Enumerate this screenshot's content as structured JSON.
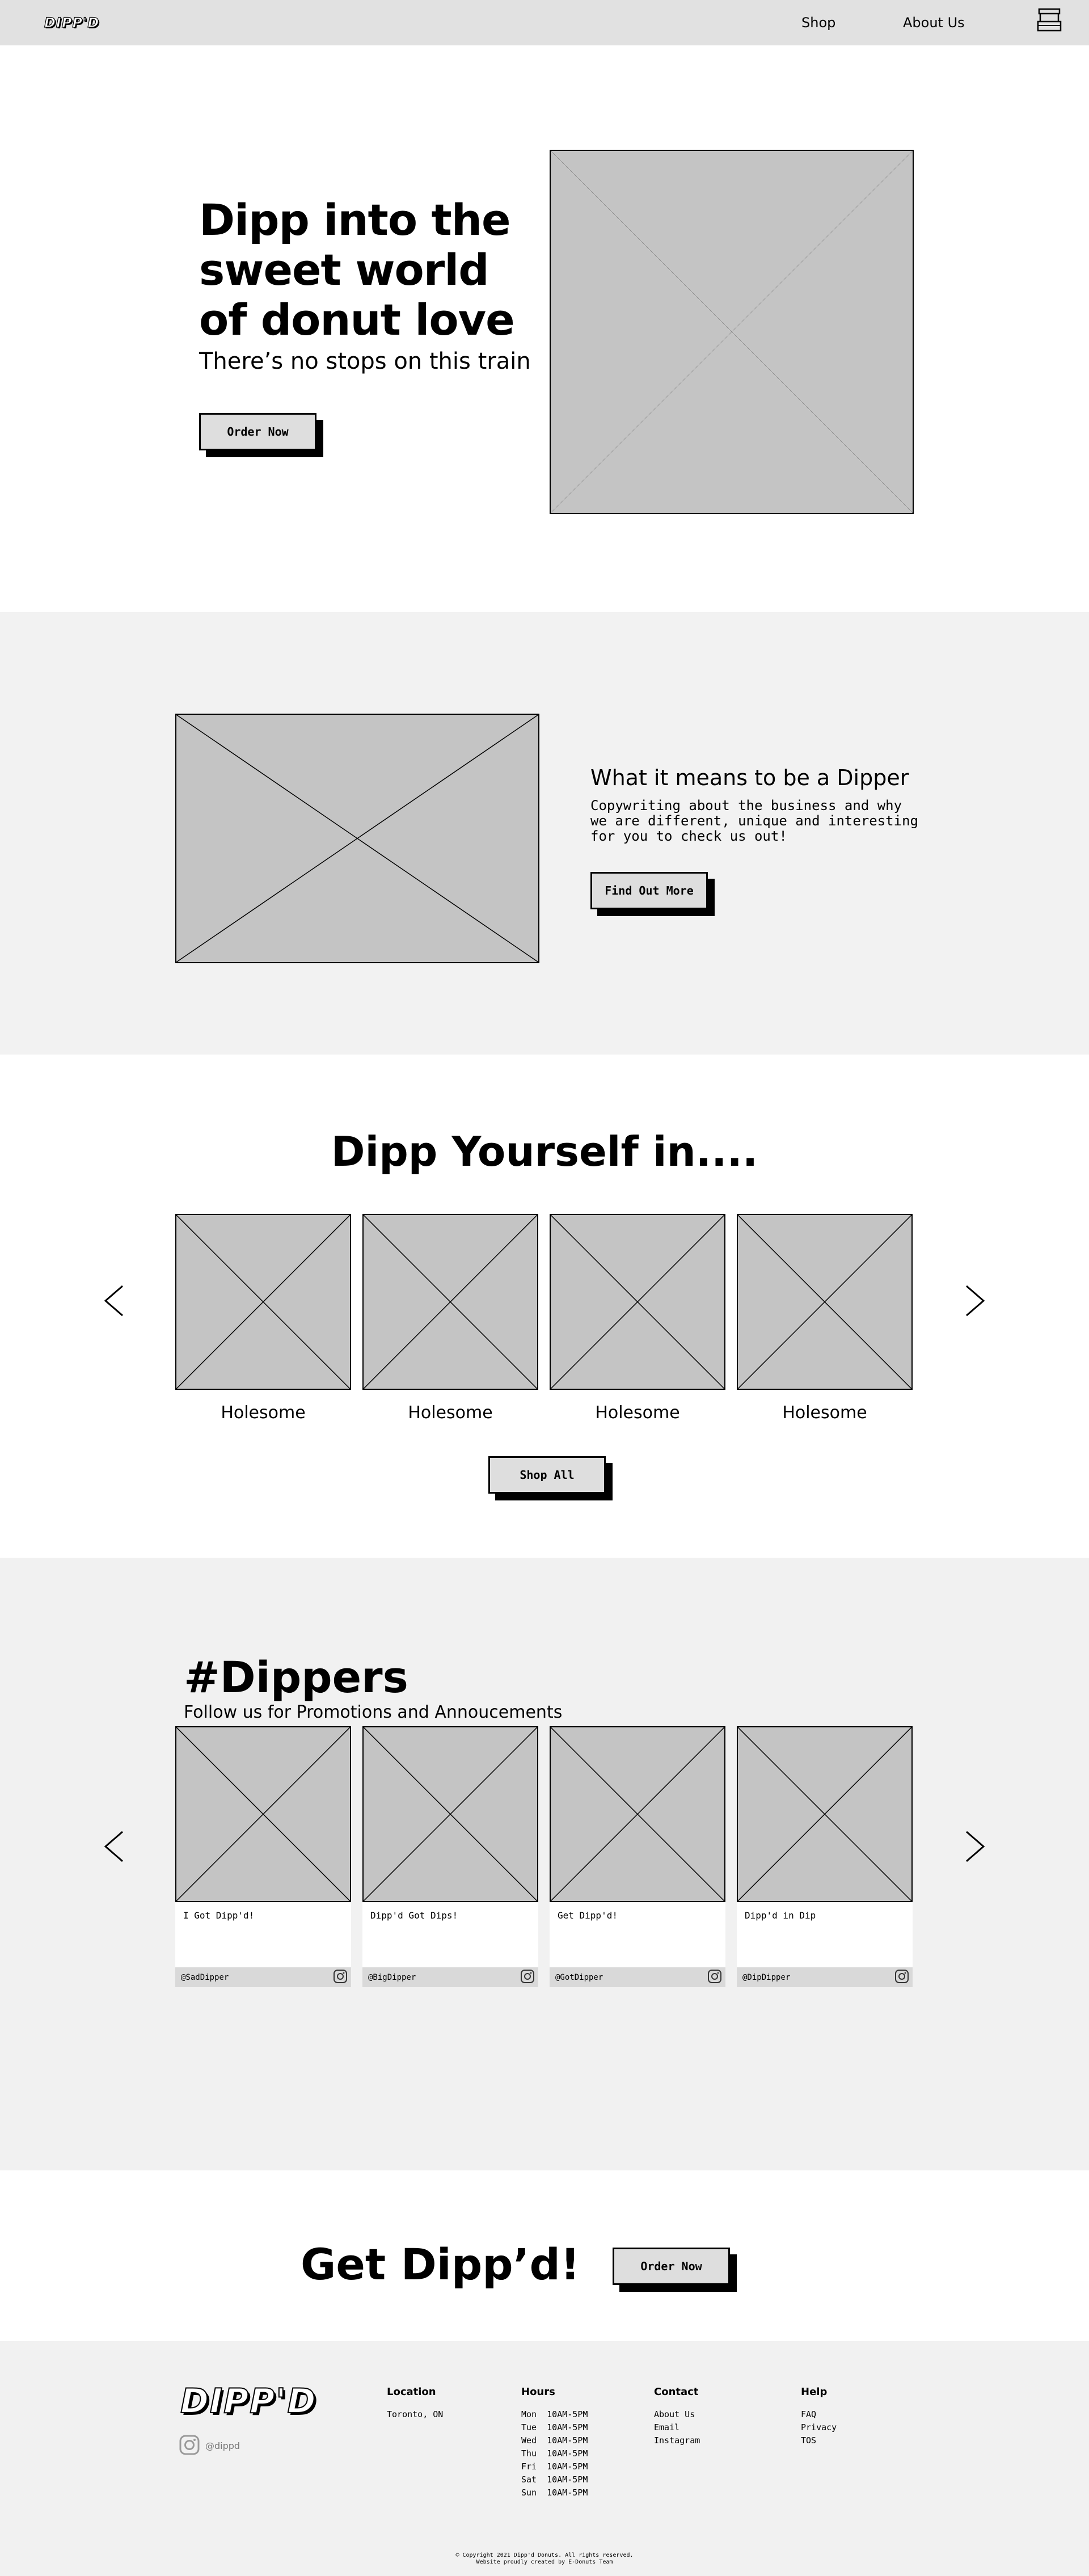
{
  "header": {
    "logo": "DIPP'D",
    "nav": [
      {
        "label": "Shop"
      },
      {
        "label": "About Us"
      }
    ],
    "cart_icon": "cart-icon"
  },
  "hero": {
    "title_lines": [
      "Dipp into the",
      "sweet world",
      "of donut love"
    ],
    "subtitle": "There’s no stops on this train",
    "cta": "Order Now"
  },
  "about": {
    "heading": "What it means to be a Dipper",
    "body": "Copywriting about the business and why we are different, unique and interesting for you to check us out!",
    "cta": "Find Out More"
  },
  "products": {
    "heading": "Dipp Yourself in....",
    "items": [
      {
        "label": "Holesome"
      },
      {
        "label": "Holesome"
      },
      {
        "label": "Holesome"
      },
      {
        "label": "Holesome"
      }
    ],
    "cta": "Shop All",
    "prev_icon": "chevron-left-icon",
    "next_icon": "chevron-right-icon"
  },
  "social": {
    "heading": "#Dippers",
    "subheading": "Follow us for Promotions and Annoucements",
    "posts": [
      {
        "caption": "I Got Dipp'd!",
        "handle": "@SadDipper"
      },
      {
        "caption": "Dipp'd Got Dips!",
        "handle": "@BigDipper"
      },
      {
        "caption": "Get Dipp'd!",
        "handle": "@GotDipper"
      },
      {
        "caption": "Dipp'd in Dip",
        "handle": "@DipDipper"
      }
    ]
  },
  "cta_band": {
    "heading": "Get Dipp’d!",
    "cta": "Order Now"
  },
  "footer": {
    "logo": "DIPP'D",
    "instagram_handle": "@dippd",
    "location": {
      "heading": "Location",
      "lines": [
        "Toronto, ON"
      ]
    },
    "hours": {
      "heading": "Hours",
      "rows": [
        {
          "day": "Mon",
          "time": "10AM-5PM"
        },
        {
          "day": "Tue",
          "time": "10AM-5PM"
        },
        {
          "day": "Wed",
          "time": "10AM-5PM"
        },
        {
          "day": "Thu",
          "time": "10AM-5PM"
        },
        {
          "day": "Fri",
          "time": "10AM-5PM"
        },
        {
          "day": "Sat",
          "time": "10AM-5PM"
        },
        {
          "day": "Sun",
          "time": "10AM-5PM"
        }
      ]
    },
    "contact": {
      "heading": "Contact",
      "items": [
        {
          "label": "About Us"
        },
        {
          "label": "Email"
        },
        {
          "label": "Instagram"
        }
      ]
    },
    "help": {
      "heading": "Help",
      "items": [
        {
          "label": "FAQ"
        },
        {
          "label": "Privacy"
        },
        {
          "label": "TOS"
        }
      ]
    },
    "copyright": "© Copyright 2021 Dipp'd Donuts. All rights reserved.",
    "credit": "Website proudly created by E-Donuts Team"
  }
}
